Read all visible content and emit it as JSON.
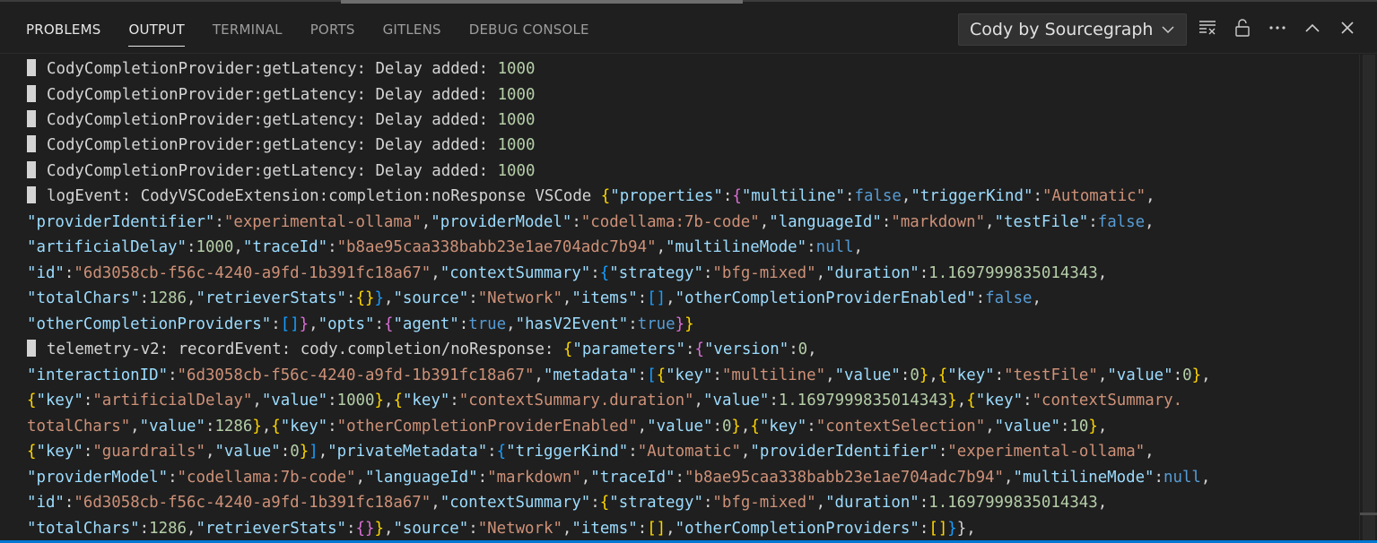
{
  "tabs": [
    {
      "label": "PROBLEMS",
      "active": false
    },
    {
      "label": "OUTPUT",
      "active": true
    },
    {
      "label": "TERMINAL",
      "active": false
    },
    {
      "label": "PORTS",
      "active": false
    },
    {
      "label": "GITLENS",
      "active": false
    },
    {
      "label": "DEBUG CONSOLE",
      "active": false
    }
  ],
  "channel": {
    "selected": "Cody by Sourcegraph"
  },
  "icons": {
    "clear": "clear-output-icon",
    "lock": "unlock-icon",
    "more": "more-actions-icon",
    "maximize": "chevron-up-icon",
    "close": "close-icon",
    "dropdown": "chevron-down-icon"
  },
  "colors": {
    "key": "#9cdcfe",
    "string": "#ce9178",
    "number": "#b5cea8",
    "keyword": "#569cd6",
    "accent": "#0078d4"
  },
  "log_lines": [
    [
      [
        "m",
        ""
      ],
      [
        "p",
        "CodyCompletionProvider:getLatency: Delay added: "
      ],
      [
        "n",
        "1000"
      ]
    ],
    [
      [
        "m",
        ""
      ],
      [
        "p",
        "CodyCompletionProvider:getLatency: Delay added: "
      ],
      [
        "n",
        "1000"
      ]
    ],
    [
      [
        "m",
        ""
      ],
      [
        "p",
        "CodyCompletionProvider:getLatency: Delay added: "
      ],
      [
        "n",
        "1000"
      ]
    ],
    [
      [
        "m",
        ""
      ],
      [
        "p",
        "CodyCompletionProvider:getLatency: Delay added: "
      ],
      [
        "n",
        "1000"
      ]
    ],
    [
      [
        "m",
        ""
      ],
      [
        "p",
        "CodyCompletionProvider:getLatency: Delay added: "
      ],
      [
        "n",
        "1000"
      ]
    ],
    [
      [
        "m",
        ""
      ],
      [
        "p",
        "logEvent: CodyVSCodeExtension:completion:noResponse VSCode "
      ],
      [
        "br",
        "{"
      ],
      [
        "k",
        "\"properties\""
      ],
      [
        "p",
        ":"
      ],
      [
        "bp",
        "{"
      ],
      [
        "k",
        "\"multiline\""
      ],
      [
        "p",
        ":"
      ],
      [
        "b",
        "false"
      ],
      [
        "p",
        ","
      ],
      [
        "k",
        "\"triggerKind\""
      ],
      [
        "p",
        ":"
      ],
      [
        "s",
        "\"Automatic\""
      ],
      [
        "p",
        ","
      ]
    ],
    [
      [
        "k",
        "\"providerIdentifier\""
      ],
      [
        "p",
        ":"
      ],
      [
        "s",
        "\"experimental-ollama\""
      ],
      [
        "p",
        ","
      ],
      [
        "k",
        "\"providerModel\""
      ],
      [
        "p",
        ":"
      ],
      [
        "s",
        "\"codellama:7b-code\""
      ],
      [
        "p",
        ","
      ],
      [
        "k",
        "\"languageId\""
      ],
      [
        "p",
        ":"
      ],
      [
        "s",
        "\"markdown\""
      ],
      [
        "p",
        ","
      ],
      [
        "k",
        "\"testFile\""
      ],
      [
        "p",
        ":"
      ],
      [
        "b",
        "false"
      ],
      [
        "p",
        ","
      ]
    ],
    [
      [
        "k",
        "\"artificialDelay\""
      ],
      [
        "p",
        ":"
      ],
      [
        "n",
        "1000"
      ],
      [
        "p",
        ","
      ],
      [
        "k",
        "\"traceId\""
      ],
      [
        "p",
        ":"
      ],
      [
        "s",
        "\"b8ae95caa338babb23e1ae704adc7b94\""
      ],
      [
        "p",
        ","
      ],
      [
        "k",
        "\"multilineMode\""
      ],
      [
        "p",
        ":"
      ],
      [
        "b",
        "null"
      ],
      [
        "p",
        ","
      ]
    ],
    [
      [
        "k",
        "\"id\""
      ],
      [
        "p",
        ":"
      ],
      [
        "s",
        "\"6d3058cb-f56c-4240-a9fd-1b391fc18a67\""
      ],
      [
        "p",
        ","
      ],
      [
        "k",
        "\"contextSummary\""
      ],
      [
        "p",
        ":"
      ],
      [
        "bb",
        "{"
      ],
      [
        "k",
        "\"strategy\""
      ],
      [
        "p",
        ":"
      ],
      [
        "s",
        "\"bfg-mixed\""
      ],
      [
        "p",
        ","
      ],
      [
        "k",
        "\"duration\""
      ],
      [
        "p",
        ":"
      ],
      [
        "n",
        "1.1697999835014343"
      ],
      [
        "p",
        ","
      ]
    ],
    [
      [
        "k",
        "\"totalChars\""
      ],
      [
        "p",
        ":"
      ],
      [
        "n",
        "1286"
      ],
      [
        "p",
        ","
      ],
      [
        "k",
        "\"retrieverStats\""
      ],
      [
        "p",
        ":"
      ],
      [
        "br",
        "{}"
      ],
      [
        "bb",
        "}"
      ],
      [
        "p",
        ","
      ],
      [
        "k",
        "\"source\""
      ],
      [
        "p",
        ":"
      ],
      [
        "s",
        "\"Network\""
      ],
      [
        "p",
        ","
      ],
      [
        "k",
        "\"items\""
      ],
      [
        "p",
        ":"
      ],
      [
        "bb",
        "[]"
      ],
      [
        "p",
        ","
      ],
      [
        "k",
        "\"otherCompletionProviderEnabled\""
      ],
      [
        "p",
        ":"
      ],
      [
        "b",
        "false"
      ],
      [
        "p",
        ","
      ]
    ],
    [
      [
        "k",
        "\"otherCompletionProviders\""
      ],
      [
        "p",
        ":"
      ],
      [
        "bb",
        "[]"
      ],
      [
        "bp",
        "}"
      ],
      [
        "p",
        ","
      ],
      [
        "k",
        "\"opts\""
      ],
      [
        "p",
        ":"
      ],
      [
        "bp",
        "{"
      ],
      [
        "k",
        "\"agent\""
      ],
      [
        "p",
        ":"
      ],
      [
        "b",
        "true"
      ],
      [
        "p",
        ","
      ],
      [
        "k",
        "\"hasV2Event\""
      ],
      [
        "p",
        ":"
      ],
      [
        "b",
        "true"
      ],
      [
        "bp",
        "}"
      ],
      [
        "br",
        "}"
      ]
    ],
    [
      [
        "m",
        ""
      ],
      [
        "p",
        "telemetry-v2: recordEvent: cody.completion/noResponse: "
      ],
      [
        "br",
        "{"
      ],
      [
        "k",
        "\"parameters\""
      ],
      [
        "p",
        ":"
      ],
      [
        "bp",
        "{"
      ],
      [
        "k",
        "\"version\""
      ],
      [
        "p",
        ":"
      ],
      [
        "n",
        "0"
      ],
      [
        "p",
        ","
      ]
    ],
    [
      [
        "k",
        "\"interactionID\""
      ],
      [
        "p",
        ":"
      ],
      [
        "s",
        "\"6d3058cb-f56c-4240-a9fd-1b391fc18a67\""
      ],
      [
        "p",
        ","
      ],
      [
        "k",
        "\"metadata\""
      ],
      [
        "p",
        ":"
      ],
      [
        "bb",
        "["
      ],
      [
        "br",
        "{"
      ],
      [
        "k",
        "\"key\""
      ],
      [
        "p",
        ":"
      ],
      [
        "s",
        "\"multiline\""
      ],
      [
        "p",
        ","
      ],
      [
        "k",
        "\"value\""
      ],
      [
        "p",
        ":"
      ],
      [
        "n",
        "0"
      ],
      [
        "br",
        "}"
      ],
      [
        "p",
        ","
      ],
      [
        "br",
        "{"
      ],
      [
        "k",
        "\"key\""
      ],
      [
        "p",
        ":"
      ],
      [
        "s",
        "\"testFile\""
      ],
      [
        "p",
        ","
      ],
      [
        "k",
        "\"value\""
      ],
      [
        "p",
        ":"
      ],
      [
        "n",
        "0"
      ],
      [
        "br",
        "}"
      ],
      [
        "p",
        ","
      ]
    ],
    [
      [
        "br",
        "{"
      ],
      [
        "k",
        "\"key\""
      ],
      [
        "p",
        ":"
      ],
      [
        "s",
        "\"artificialDelay\""
      ],
      [
        "p",
        ","
      ],
      [
        "k",
        "\"value\""
      ],
      [
        "p",
        ":"
      ],
      [
        "n",
        "1000"
      ],
      [
        "br",
        "}"
      ],
      [
        "p",
        ","
      ],
      [
        "br",
        "{"
      ],
      [
        "k",
        "\"key\""
      ],
      [
        "p",
        ":"
      ],
      [
        "s",
        "\"contextSummary.duration\""
      ],
      [
        "p",
        ","
      ],
      [
        "k",
        "\"value\""
      ],
      [
        "p",
        ":"
      ],
      [
        "n",
        "1.1697999835014343"
      ],
      [
        "br",
        "}"
      ],
      [
        "p",
        ","
      ],
      [
        "br",
        "{"
      ],
      [
        "k",
        "\"key\""
      ],
      [
        "p",
        ":"
      ],
      [
        "s",
        "\"contextSummary."
      ]
    ],
    [
      [
        "s",
        "totalChars\""
      ],
      [
        "p",
        ","
      ],
      [
        "k",
        "\"value\""
      ],
      [
        "p",
        ":"
      ],
      [
        "n",
        "1286"
      ],
      [
        "br",
        "}"
      ],
      [
        "p",
        ","
      ],
      [
        "br",
        "{"
      ],
      [
        "k",
        "\"key\""
      ],
      [
        "p",
        ":"
      ],
      [
        "s",
        "\"otherCompletionProviderEnabled\""
      ],
      [
        "p",
        ","
      ],
      [
        "k",
        "\"value\""
      ],
      [
        "p",
        ":"
      ],
      [
        "n",
        "0"
      ],
      [
        "br",
        "}"
      ],
      [
        "p",
        ","
      ],
      [
        "br",
        "{"
      ],
      [
        "k",
        "\"key\""
      ],
      [
        "p",
        ":"
      ],
      [
        "s",
        "\"contextSelection\""
      ],
      [
        "p",
        ","
      ],
      [
        "k",
        "\"value\""
      ],
      [
        "p",
        ":"
      ],
      [
        "n",
        "10"
      ],
      [
        "br",
        "}"
      ],
      [
        "p",
        ","
      ]
    ],
    [
      [
        "br",
        "{"
      ],
      [
        "k",
        "\"key\""
      ],
      [
        "p",
        ":"
      ],
      [
        "s",
        "\"guardrails\""
      ],
      [
        "p",
        ","
      ],
      [
        "k",
        "\"value\""
      ],
      [
        "p",
        ":"
      ],
      [
        "n",
        "0"
      ],
      [
        "br",
        "}"
      ],
      [
        "bb",
        "]"
      ],
      [
        "p",
        ","
      ],
      [
        "k",
        "\"privateMetadata\""
      ],
      [
        "p",
        ":"
      ],
      [
        "bb",
        "{"
      ],
      [
        "k",
        "\"triggerKind\""
      ],
      [
        "p",
        ":"
      ],
      [
        "s",
        "\"Automatic\""
      ],
      [
        "p",
        ","
      ],
      [
        "k",
        "\"providerIdentifier\""
      ],
      [
        "p",
        ":"
      ],
      [
        "s",
        "\"experimental-ollama\""
      ],
      [
        "p",
        ","
      ]
    ],
    [
      [
        "k",
        "\"providerModel\""
      ],
      [
        "p",
        ":"
      ],
      [
        "s",
        "\"codellama:7b-code\""
      ],
      [
        "p",
        ","
      ],
      [
        "k",
        "\"languageId\""
      ],
      [
        "p",
        ":"
      ],
      [
        "s",
        "\"markdown\""
      ],
      [
        "p",
        ","
      ],
      [
        "k",
        "\"traceId\""
      ],
      [
        "p",
        ":"
      ],
      [
        "s",
        "\"b8ae95caa338babb23e1ae704adc7b94\""
      ],
      [
        "p",
        ","
      ],
      [
        "k",
        "\"multilineMode\""
      ],
      [
        "p",
        ":"
      ],
      [
        "b",
        "null"
      ],
      [
        "p",
        ","
      ]
    ],
    [
      [
        "k",
        "\"id\""
      ],
      [
        "p",
        ":"
      ],
      [
        "s",
        "\"6d3058cb-f56c-4240-a9fd-1b391fc18a67\""
      ],
      [
        "p",
        ","
      ],
      [
        "k",
        "\"contextSummary\""
      ],
      [
        "p",
        ":"
      ],
      [
        "br",
        "{"
      ],
      [
        "k",
        "\"strategy\""
      ],
      [
        "p",
        ":"
      ],
      [
        "s",
        "\"bfg-mixed\""
      ],
      [
        "p",
        ","
      ],
      [
        "k",
        "\"duration\""
      ],
      [
        "p",
        ":"
      ],
      [
        "n",
        "1.1697999835014343"
      ],
      [
        "p",
        ","
      ]
    ],
    [
      [
        "k",
        "\"totalChars\""
      ],
      [
        "p",
        ":"
      ],
      [
        "n",
        "1286"
      ],
      [
        "p",
        ","
      ],
      [
        "k",
        "\"retrieverStats\""
      ],
      [
        "p",
        ":"
      ],
      [
        "bp",
        "{}"
      ],
      [
        "br",
        "}"
      ],
      [
        "p",
        ","
      ],
      [
        "k",
        "\"source\""
      ],
      [
        "p",
        ":"
      ],
      [
        "s",
        "\"Network\""
      ],
      [
        "p",
        ","
      ],
      [
        "k",
        "\"items\""
      ],
      [
        "p",
        ":"
      ],
      [
        "br",
        "[]"
      ],
      [
        "p",
        ","
      ],
      [
        "k",
        "\"otherCompletionProviders\""
      ],
      [
        "p",
        ":"
      ],
      [
        "br",
        "[]"
      ],
      [
        "bb",
        "}"
      ],
      [
        "p",
        "},"
      ]
    ]
  ]
}
